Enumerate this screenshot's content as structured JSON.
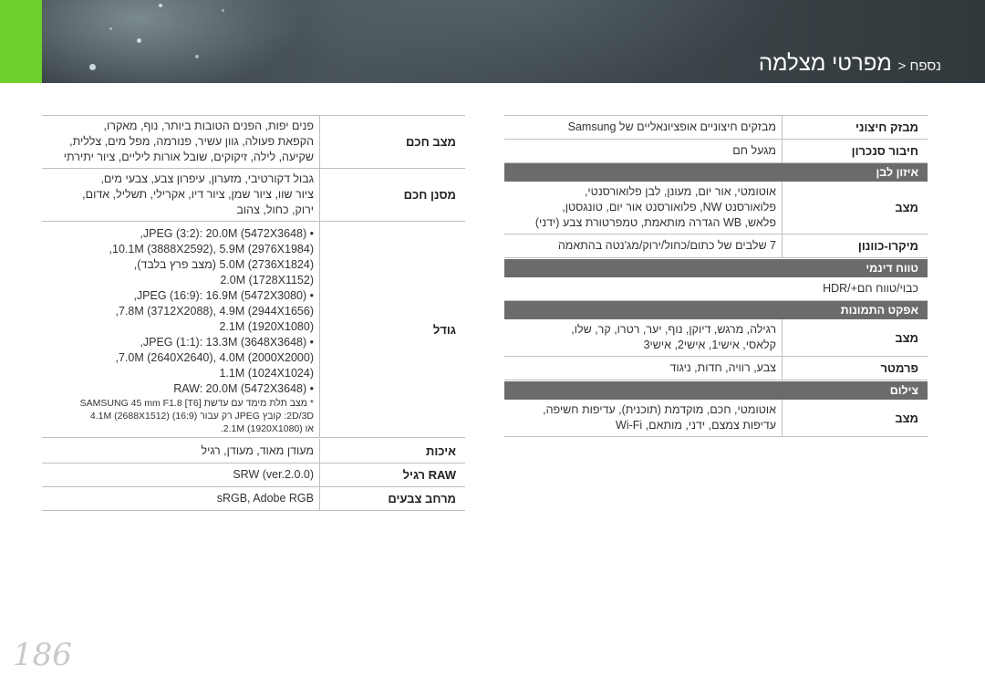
{
  "header": {
    "breadcrumb_prefix": "נספח <",
    "title": "מפרטי מצלמה"
  },
  "right_table": {
    "rows_top": [
      {
        "label": "מבזק חיצוני",
        "value": "מבזקים חיצוניים אופציונאליים של Samsung"
      },
      {
        "label": "חיבור סנכרון",
        "value": "מגעל חם"
      }
    ],
    "section_wb": "איזון לבן",
    "wb_row": {
      "label": "מצב",
      "lines": [
        "אוטומטי, אור יום, מעונן, לבן פלואורסנטי,",
        "פלואורסנט NW, פלואורסנט אור יום, טונגסטן,",
        "פלאש, WB הגדרה מותאמת, טמפרטורת צבע (ידני)"
      ]
    },
    "micro_row": {
      "label": "מיקרו-כוונון",
      "value": "7 שלבים של כתום/כחול/ירוק/מג'נטה בהתאמה"
    },
    "section_dr": "טווח דינמי",
    "dr_value": "כבוי/טווח חם+/HDR",
    "section_effects": "אפקט התמונות",
    "effects_row": {
      "label": "מצב",
      "lines": [
        "רגילה, מרגש, דיוקן, נוף, יער, רטרו, קר, שלו,",
        "קלאסי, אישי1, אישי2, אישי3"
      ]
    },
    "params_row": {
      "label": "פרמטר",
      "value": "צבע, רוויה, חדות, ניגוד"
    },
    "section_shoot": "צילום",
    "shoot_row": {
      "label": "מצב",
      "lines": [
        "אוטומטי, חכם, מוקדמת (תוכנית), עדיפות חשיפה,",
        "עדיפות צמצם, ידני, מותאם, Wi-Fi"
      ]
    }
  },
  "left_table": {
    "smart_mode": {
      "label": "מצב חכם",
      "lines": [
        "פנים יפות, הפנים הטובות ביותר, נוף, מאקרו,",
        "הקפאת פעולה, גוון עשיר, פנורמה, מפל מים, צללית,",
        "שקיעה, לילה, זיקוקים, שובל אורות ליליים, ציור יתירתי"
      ]
    },
    "smart_filter": {
      "label": "מסנן חכם",
      "lines": [
        "גבול דקורטיבי, מזערון, עיפרון צבע, צבעי מים,",
        "ציור שוו, ציור שמן, ציור דיו, אקרילי, תשליל, אדום,",
        "ירוק, כחול, צהוב"
      ]
    },
    "size": {
      "label": "גודל",
      "lines": [
        "• JPEG (3:2): 20.0M (5472X3648),",
        "10.1M (3888X2592), 5.9M (2976X1984),",
        "5.0M (2736X1824) (מצב פרץ בלבד),",
        "2.0M (1728X1152)",
        "• JPEG (16:9): 16.9M (5472X3080),",
        "7.8M (3712X2088), 4.9M (2944X1656),",
        "2.1M (1920X1080)",
        "• JPEG (1:1): 13.3M (3648X3648),",
        "7.0M (2640X2640), 4.0M (2000X2000),",
        "1.1M (1024X1024)",
        "• RAW: 20.0M (5472X3648)"
      ],
      "notes": [
        "* מצב תלת מימד עם עדשת SAMSUNG 45 mm F1.8 [T6]",
        "2D/3D: קובץ JPEG רק עבור (16:9) 4.1M (2688X1512)",
        "או 2.1M (1920X1080)."
      ]
    },
    "quality": {
      "label": "איכות",
      "value": "מעודן מאוד, מעודן, רגיל"
    },
    "raw": {
      "label": "RAW רגיל",
      "value": "SRW (ver.2.0.0)"
    },
    "color_space": {
      "label": "מרחב צבעים",
      "value": "sRGB, Adobe RGB"
    }
  },
  "page_number": "186"
}
